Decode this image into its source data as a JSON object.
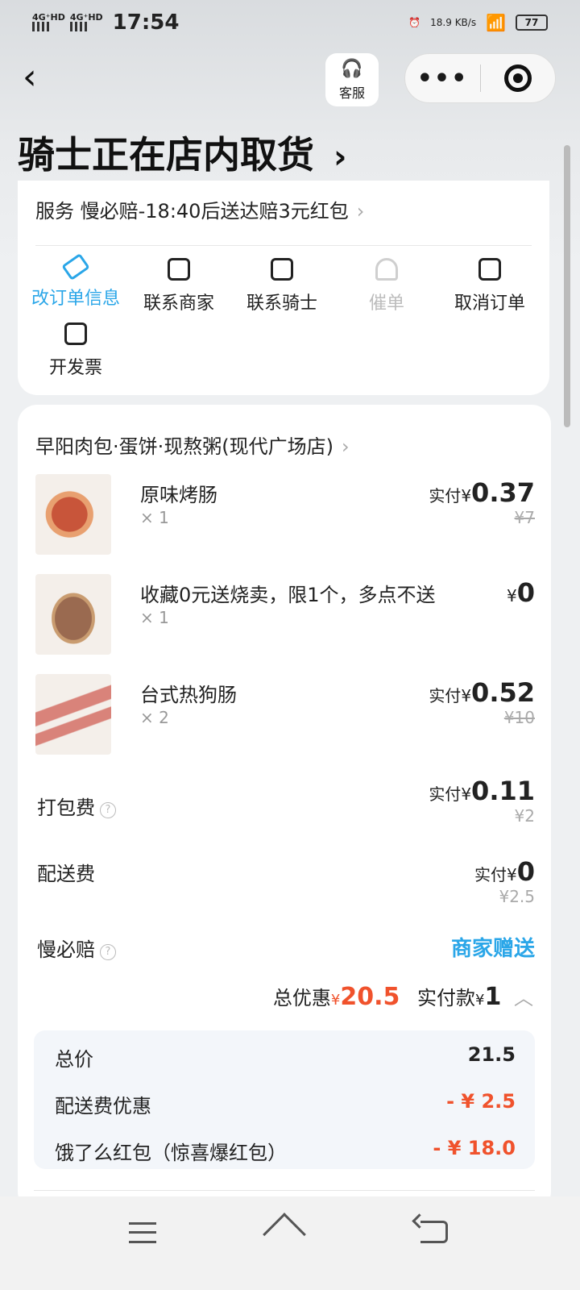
{
  "status_bar": {
    "signal1": "4G⁺HD",
    "signal2": "4G⁺HD",
    "time": "17:54",
    "net_speed": "18.9 KB/s",
    "battery": "77"
  },
  "header": {
    "back_icon": "chevron-left-icon",
    "customer_service_label": "客服",
    "more_icon": "more-dots-icon",
    "close_icon": "target-icon",
    "title": "骑士正在店内取货",
    "title_chevron": "›"
  },
  "service": {
    "text": "服务 慢必赔-18:40后送达赔3元红包",
    "chevron": "›"
  },
  "actions": [
    {
      "label": "改订单信息",
      "icon": "edit-icon",
      "active": true
    },
    {
      "label": "联系商家",
      "icon": "chat-icon"
    },
    {
      "label": "联系骑士",
      "icon": "chat-icon"
    },
    {
      "label": "催单",
      "icon": "bell-icon",
      "disabled": true
    },
    {
      "label": "取消订单",
      "icon": "cancel-doc-icon"
    },
    {
      "label": "开发票",
      "icon": "invoice-icon"
    }
  ],
  "shop": {
    "name": "早阳肉包·蛋饼·现熬粥(现代广场店)",
    "chevron": "›"
  },
  "items": [
    {
      "name": "原味烤肠",
      "qty": "× 1",
      "paid_prefix": "实付",
      "currency": "¥",
      "paid": "0.37",
      "original": "¥7"
    },
    {
      "name": "收藏0元送烧卖，限1个，多点不送",
      "qty": "× 1",
      "paid_prefix": "",
      "currency": "¥",
      "paid": "0",
      "original": ""
    },
    {
      "name": "台式热狗肠",
      "qty": "× 2",
      "paid_prefix": "实付",
      "currency": "¥",
      "paid": "0.52",
      "original": "¥10"
    }
  ],
  "fees": {
    "packing": {
      "label": "打包费",
      "paid_prefix": "实付",
      "currency": "¥",
      "paid": "0.11",
      "original": "¥2"
    },
    "delivery": {
      "label": "配送费",
      "paid_prefix": "实付",
      "currency": "¥",
      "paid": "0",
      "original": "¥2.5"
    },
    "slow_comp": {
      "label": "慢必赔",
      "value": "商家赠送"
    }
  },
  "totals": {
    "discount_label": "总优惠",
    "discount_currency": "¥",
    "discount": "20.5",
    "paid_label": "实付款",
    "paid_currency": "¥",
    "paid": "1"
  },
  "breakdown": [
    {
      "label": "总价",
      "value": "21.5"
    },
    {
      "label": "配送费优惠",
      "value": "- ¥ 2.5"
    },
    {
      "label": "饿了么红包（惊喜爆红包）",
      "value": "- ¥ 18.0"
    }
  ],
  "colors": {
    "accent": "#2aa6e8",
    "discount": "#f0522c"
  }
}
